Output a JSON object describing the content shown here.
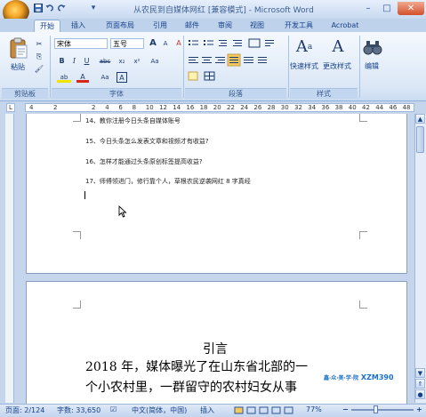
{
  "window": {
    "title": "从农民到自媒体网红 [兼容模式] - Microsoft Word",
    "controls": {
      "minimize": "–",
      "maximize": "□",
      "close": "✕"
    }
  },
  "quick_access": {
    "save": "save-icon",
    "undo": "undo-icon",
    "redo": "redo-icon",
    "more": "▾"
  },
  "tabs": [
    {
      "label": "开始"
    },
    {
      "label": "插入"
    },
    {
      "label": "页面布局"
    },
    {
      "label": "引用"
    },
    {
      "label": "邮件"
    },
    {
      "label": "审阅"
    },
    {
      "label": "视图"
    },
    {
      "label": "开发工具"
    },
    {
      "label": "Acrobat"
    }
  ],
  "ribbon": {
    "clipboard": {
      "paste_label": "粘贴",
      "group_label": "剪贴板"
    },
    "font": {
      "font_name": "宋体",
      "font_size": "五号",
      "group_label": "字体",
      "buttons": {
        "grow": "A",
        "shrink": "A",
        "clear": "A",
        "bold": "B",
        "italic": "I",
        "underline": "U",
        "strike": "abc",
        "subscript": "x₂",
        "superscript": "x²",
        "case": "Aa",
        "highlight": "ab",
        "color": "A",
        "ruby": "Aa",
        "border": "A"
      }
    },
    "paragraph": {
      "group_label": "段落"
    },
    "styles": {
      "quick_label": "快速样式",
      "change_label": "更改样式",
      "group_label": "样式"
    },
    "editing": {
      "label": "编辑"
    }
  },
  "ruler": {
    "left_numbers": [
      "4",
      "2"
    ],
    "numbers": [
      "2",
      "4",
      "6",
      "8",
      "10",
      "12",
      "14",
      "16",
      "18",
      "20",
      "22",
      "24",
      "26",
      "28",
      "30",
      "32",
      "34",
      "36",
      "38",
      "40",
      "42",
      "44",
      "46",
      "48"
    ]
  },
  "document": {
    "page1_lines": [
      "14、教你注册今日头条自媒体账号",
      "15、今日头条怎么发表文章和视频才有收益?",
      "16、怎样才能通过头条原创标签提高收益?",
      "17、师傅领进门，修行靠个人，草根农民逆袭网红 8 字真经"
    ],
    "heading": "引言",
    "body_lines": [
      "2018 年，媒体曝光了在山东省北部的一",
      "个小农村里，一群留守的农村妇女从事"
    ],
    "watermark": "XZM390",
    "watermark_prefix": "鑫·众·美·学·院"
  },
  "status": {
    "page": "页面: 2/124",
    "words": "字数: 33,650",
    "language": "中文(简体，中国)",
    "mode": "插入",
    "zoom": "77%",
    "zoom_out": "−",
    "zoom_in": "+"
  }
}
